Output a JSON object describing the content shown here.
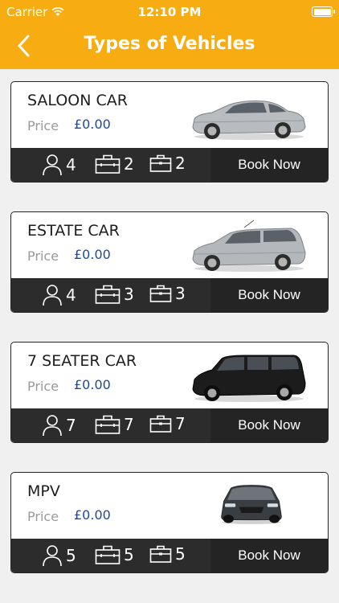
{
  "status_bar": {
    "carrier": "Carrier",
    "time": "12:10 PM"
  },
  "header": {
    "title": "Types of Vehicles"
  },
  "colors": {
    "header": "#f7ad11",
    "price": "#1d4aa0",
    "bar": "#2c2c2c"
  },
  "vehicles": [
    {
      "name": "SALOON CAR",
      "price_label": "Price",
      "price": "£0.00",
      "passengers": "4",
      "luggage": "2",
      "hand_luggage": "2",
      "book_label": "Book Now",
      "image": "silver-saloon-car"
    },
    {
      "name": "ESTATE CAR",
      "price_label": "Price",
      "price": "£0.00",
      "passengers": "4",
      "luggage": "3",
      "hand_luggage": "3",
      "book_label": "Book Now",
      "image": "silver-estate-car"
    },
    {
      "name": "7 SEATER CAR",
      "price_label": "Price",
      "price": "£0.00",
      "passengers": "7",
      "luggage": "7",
      "hand_luggage": "7",
      "book_label": "Book Now",
      "image": "black-7-seater-van"
    },
    {
      "name": "MPV",
      "price_label": "Price",
      "price": "£0.00",
      "passengers": "5",
      "luggage": "5",
      "hand_luggage": "5",
      "book_label": "Book Now",
      "image": "dark-mpv-car"
    }
  ]
}
